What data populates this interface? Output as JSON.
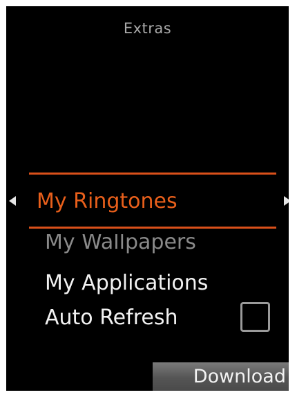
{
  "header": {
    "title": "Extras"
  },
  "menu": {
    "selected": "My Ringtones",
    "items": [
      {
        "label": "My Wallpapers"
      },
      {
        "label": "My Applications"
      },
      {
        "label": "Auto Refresh"
      }
    ],
    "auto_refresh_checked": false
  },
  "softkeys": {
    "right_label": "Download"
  },
  "colors": {
    "accent": "#d9501a",
    "background": "#000000",
    "text": "#f2f2f2"
  }
}
